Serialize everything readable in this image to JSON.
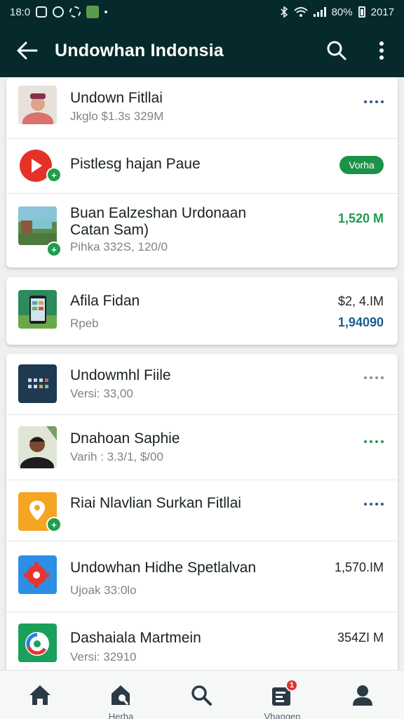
{
  "status_bar": {
    "time": "18:0",
    "battery": "80%",
    "clock_right": "2017"
  },
  "app_bar": {
    "title": "Undowhan Indonsia",
    "back_icon": "arrow-left-icon",
    "search_icon": "search-icon",
    "more_icon": "more-vertical-icon"
  },
  "colors": {
    "app_bar_bg": "#062a2c",
    "green": "#1b9247",
    "blue": "#1a5f8e",
    "grey_dots": "#8a9093"
  },
  "cards": [
    {
      "items": [
        {
          "title": "Undown Fitllai",
          "subtitle": "Jkglo  $1.3s 329M",
          "right_type": "dots",
          "dots_color": "#2a5a8a",
          "thumb": "person-photo"
        },
        {
          "title": "Pistlesg hajan Paue",
          "subtitle": "",
          "right_type": "pill",
          "pill_label": "Vorha",
          "thumb": "youtube-icon"
        },
        {
          "title": "Buan Ealzeshan Urdonaan",
          "title2": "Catan Sam)",
          "subtitle": "Pihka  332S, 120/0",
          "right_type": "value",
          "value": "1,520 M",
          "value_color": "#1f9a4d",
          "thumb": "landscape-photo"
        }
      ]
    },
    {
      "items": [
        {
          "title": "Afila Fidan",
          "subtitle": "Rpeb",
          "right_type": "value2",
          "value": "$2, 4.IM",
          "value2": "1,94090",
          "value2_color": "#1a5f8e",
          "thumb": "phone-photo"
        }
      ]
    },
    {
      "items": [
        {
          "title": "Undowmhl Fiile",
          "subtitle": "Versi: 33,00",
          "right_type": "dots",
          "dots_color": "#8a9093",
          "thumb": "grid-app-icon"
        },
        {
          "title": "Dnahoan Saphie",
          "subtitle": "Varih : 3.3/1, $/00",
          "right_type": "dots",
          "dots_color": "#1f9a4d",
          "thumb": "man-photo"
        },
        {
          "title": "Riai Nlavlian Surkan Fitllai",
          "subtitle": "",
          "right_type": "dots",
          "dots_color": "#2a5a8a",
          "thumb": "maps-pin-icon"
        },
        {
          "title": "Undowhan Hidhe Spetlalvan",
          "subtitle": "Ujoak  33:0lo",
          "right_type": "value",
          "value": "1,570.IM",
          "value_color": "#1d2326",
          "thumb": "red-gear-icon"
        },
        {
          "title": "Dashaiala Martmein",
          "subtitle": "Versi: 32910",
          "right_type": "value",
          "value": "354ZI M",
          "value_color": "#1d2326",
          "thumb": "green-logo-icon"
        }
      ]
    }
  ],
  "bottom_nav": [
    {
      "icon": "home-icon",
      "label": ""
    },
    {
      "icon": "apps-home-icon",
      "label": "Herha"
    },
    {
      "icon": "search-icon",
      "label": ""
    },
    {
      "icon": "updates-icon",
      "label": "Vhangen",
      "badge": "1"
    },
    {
      "icon": "profile-icon",
      "label": ""
    }
  ]
}
